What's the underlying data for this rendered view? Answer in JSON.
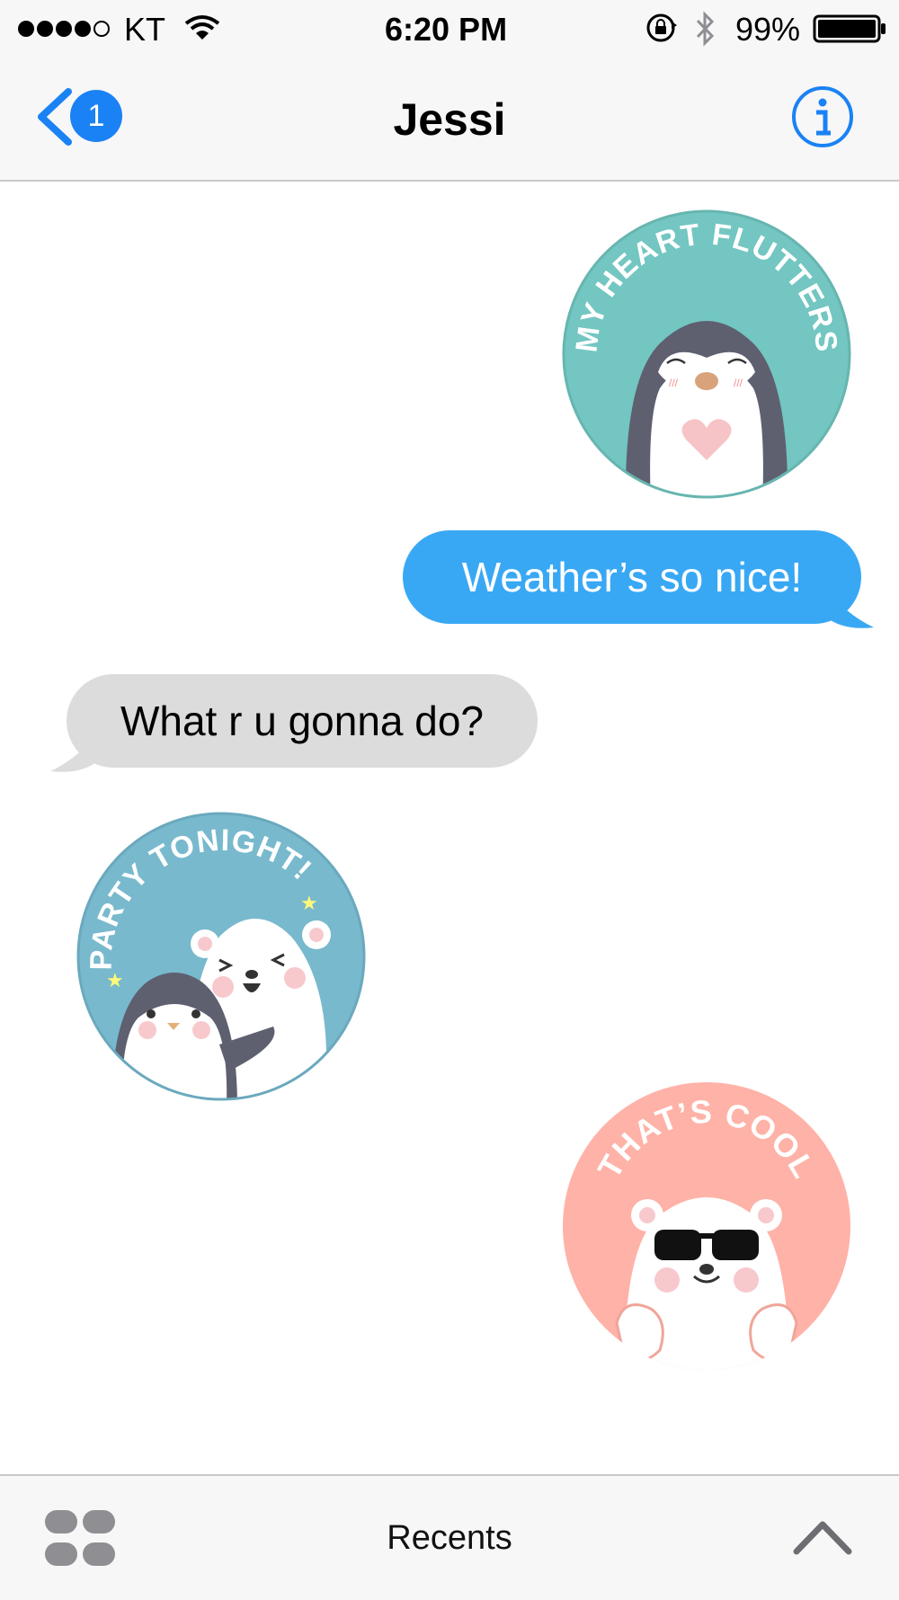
{
  "status_bar": {
    "carrier": "KT",
    "time": "6:20 PM",
    "battery": "99%",
    "signal_icon": "signal-dots-icon",
    "wifi_icon": "wifi-icon",
    "lock_icon": "rotation-lock-icon",
    "bluetooth_icon": "bluetooth-icon",
    "battery_icon": "battery-icon"
  },
  "nav": {
    "title": "Jessi",
    "back_badge": "1",
    "back_icon": "chevron-left-icon",
    "info_icon": "info-icon"
  },
  "messages": [
    {
      "type": "sticker",
      "direction": "outgoing",
      "text": "MY HEART FLUTTERS",
      "color": "#73c6c1"
    },
    {
      "type": "text",
      "direction": "outgoing",
      "text": "Weather’s so nice!"
    },
    {
      "type": "text",
      "direction": "incoming",
      "text": "What r u gonna do?"
    },
    {
      "type": "sticker",
      "direction": "incoming",
      "text": "PARTY TONIGHT!",
      "color": "#78b9cd"
    },
    {
      "type": "sticker",
      "direction": "outgoing",
      "text": "THAT’S COOL",
      "color": "#ffb2a7"
    }
  ],
  "toolbar": {
    "apps_icon": "app-drawer-icon",
    "label": "Recents",
    "expand_icon": "chevron-up-icon"
  },
  "colors": {
    "accent": "#1a82f4",
    "outgoing_bubble": "#39a8f4",
    "incoming_bubble": "#dcdcdc"
  }
}
